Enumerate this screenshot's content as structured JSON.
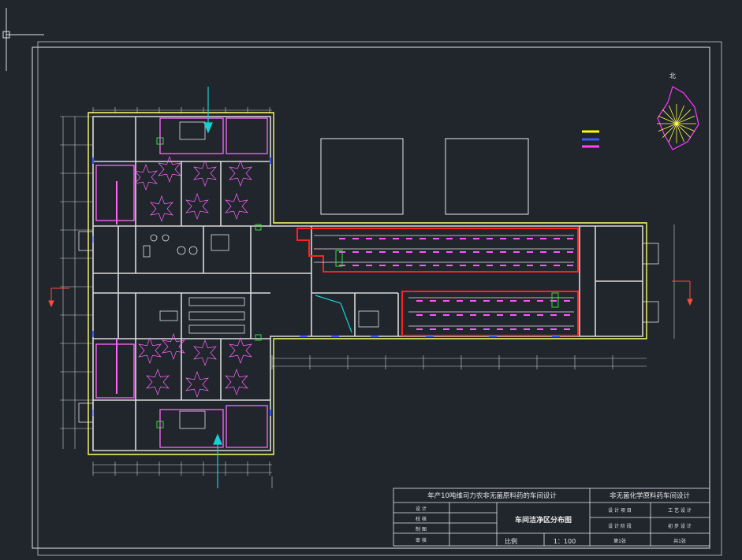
{
  "drawing": {
    "compass_label": "北",
    "legend": [
      {
        "label": "",
        "color": "#ffff00"
      },
      {
        "label": "",
        "color": "#3a5bff"
      },
      {
        "label": "",
        "color": "#ff44ff"
      }
    ],
    "entry_labels": {
      "left": "",
      "right": ""
    },
    "box_labels": {
      "left": "",
      "right": ""
    }
  },
  "title_block": {
    "project_title": "年产10吨维司力农非无菌原料药的车间设计",
    "design_subject": "非无菌化学原料药车间设计",
    "drawing_name": "车间洁净区分布图",
    "left_rows": [
      "设 计",
      "校 核",
      "制 图",
      "审 核"
    ],
    "scale_label": "比例",
    "scale_value": "1：100",
    "right_grid": [
      [
        "设 计 项 目",
        "工 艺 设 计"
      ],
      [
        "设 计 阶 段",
        "初 步 设 计"
      ]
    ],
    "sheet_no": "第1张",
    "sheet_total": "共1张"
  },
  "colors": {
    "background": "#21262d",
    "wall": "#d9d9d9",
    "clean_zone": "#ffff66",
    "partition": "#ff66ff",
    "process_line": "#ff2020",
    "equipment": "#ff55ff",
    "door": "#3a5bff",
    "arrow": "#ff4a3a",
    "cyan": "#17d1d1",
    "green": "#33dd33"
  }
}
